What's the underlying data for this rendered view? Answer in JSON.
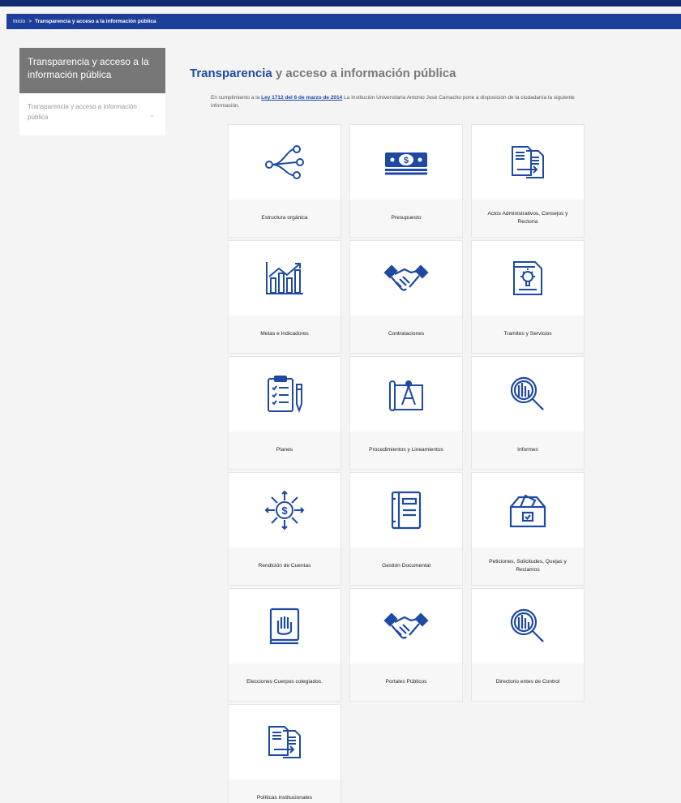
{
  "breadcrumb": {
    "home": "Inicio",
    "separator": ">",
    "current": "Transparencia y acceso a la información pública"
  },
  "sidebar": {
    "header": "Transparencia y acceso a la información pública",
    "items": [
      {
        "label": "Transparencia y acceso a información pública",
        "icon": "chevron-down-icon"
      }
    ]
  },
  "main": {
    "title_bold": "Transparencia",
    "title_rest": " y acceso a información pública",
    "intro_before": "En cumplimiento a la ",
    "intro_link": "Ley 1712 del 6 de marzo de 2014",
    "intro_after": " La Institución Universitaria Antonio José Camacho pone a disposición de la ciudadanía la siguiente información."
  },
  "cards": [
    {
      "label": "Estructura orgánica",
      "icon": "org-structure-icon"
    },
    {
      "label": "Presupuesto",
      "icon": "money-icon"
    },
    {
      "label": "Actos Administrativos, Consejos y Rectoría",
      "icon": "documents-transfer-icon"
    },
    {
      "label": "Metas e Indicadores",
      "icon": "bar-chart-icon"
    },
    {
      "label": "Contrataciones",
      "icon": "handshake-icon"
    },
    {
      "label": "Tramites y Servicios",
      "icon": "document-lightbulb-icon"
    },
    {
      "label": "Planes",
      "icon": "clipboard-checklist-icon"
    },
    {
      "label": "Procedimientos y Lineamientos",
      "icon": "blueprint-compass-icon"
    },
    {
      "label": "Informes",
      "icon": "magnifier-report-icon"
    },
    {
      "label": "Rendición de Cuentas",
      "icon": "money-arrows-icon"
    },
    {
      "label": "Gestión Documental",
      "icon": "binder-icon"
    },
    {
      "label": "Peticiones, Solicitudes, Quejas y Reclamos",
      "icon": "ballot-box-icon"
    },
    {
      "label": "Elecciones Cuerpos colegiados.",
      "icon": "hand-vote-book-icon"
    },
    {
      "label": "Portales Públicos",
      "icon": "handshake-icon"
    },
    {
      "label": "Directorio entes de Control",
      "icon": "magnifier-report-icon"
    },
    {
      "label": "Políticas institucionales",
      "icon": "documents-transfer-icon"
    }
  ],
  "colors": {
    "accent": "#1e4aa3",
    "breadcrumb_bg": "#1b3f9a",
    "sidebar_header_bg": "#777777"
  }
}
